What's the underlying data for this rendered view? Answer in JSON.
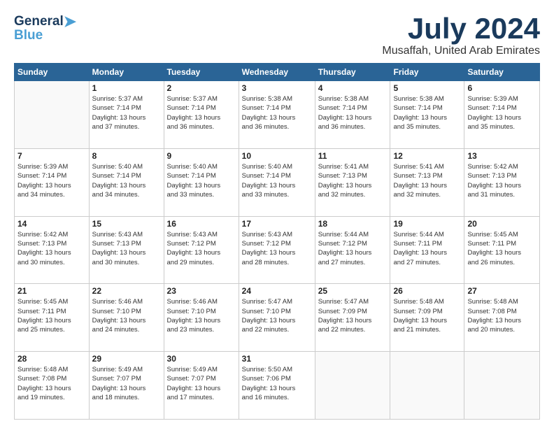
{
  "logo": {
    "line1": "General",
    "line2": "Blue"
  },
  "title": "July 2024",
  "subtitle": "Musaffah, United Arab Emirates",
  "days_header": [
    "Sunday",
    "Monday",
    "Tuesday",
    "Wednesday",
    "Thursday",
    "Friday",
    "Saturday"
  ],
  "weeks": [
    [
      {
        "day": "",
        "info": ""
      },
      {
        "day": "1",
        "info": "Sunrise: 5:37 AM\nSunset: 7:14 PM\nDaylight: 13 hours\nand 37 minutes."
      },
      {
        "day": "2",
        "info": "Sunrise: 5:37 AM\nSunset: 7:14 PM\nDaylight: 13 hours\nand 36 minutes."
      },
      {
        "day": "3",
        "info": "Sunrise: 5:38 AM\nSunset: 7:14 PM\nDaylight: 13 hours\nand 36 minutes."
      },
      {
        "day": "4",
        "info": "Sunrise: 5:38 AM\nSunset: 7:14 PM\nDaylight: 13 hours\nand 36 minutes."
      },
      {
        "day": "5",
        "info": "Sunrise: 5:38 AM\nSunset: 7:14 PM\nDaylight: 13 hours\nand 35 minutes."
      },
      {
        "day": "6",
        "info": "Sunrise: 5:39 AM\nSunset: 7:14 PM\nDaylight: 13 hours\nand 35 minutes."
      }
    ],
    [
      {
        "day": "7",
        "info": "Sunrise: 5:39 AM\nSunset: 7:14 PM\nDaylight: 13 hours\nand 34 minutes."
      },
      {
        "day": "8",
        "info": "Sunrise: 5:40 AM\nSunset: 7:14 PM\nDaylight: 13 hours\nand 34 minutes."
      },
      {
        "day": "9",
        "info": "Sunrise: 5:40 AM\nSunset: 7:14 PM\nDaylight: 13 hours\nand 33 minutes."
      },
      {
        "day": "10",
        "info": "Sunrise: 5:40 AM\nSunset: 7:14 PM\nDaylight: 13 hours\nand 33 minutes."
      },
      {
        "day": "11",
        "info": "Sunrise: 5:41 AM\nSunset: 7:13 PM\nDaylight: 13 hours\nand 32 minutes."
      },
      {
        "day": "12",
        "info": "Sunrise: 5:41 AM\nSunset: 7:13 PM\nDaylight: 13 hours\nand 32 minutes."
      },
      {
        "day": "13",
        "info": "Sunrise: 5:42 AM\nSunset: 7:13 PM\nDaylight: 13 hours\nand 31 minutes."
      }
    ],
    [
      {
        "day": "14",
        "info": "Sunrise: 5:42 AM\nSunset: 7:13 PM\nDaylight: 13 hours\nand 30 minutes."
      },
      {
        "day": "15",
        "info": "Sunrise: 5:43 AM\nSunset: 7:13 PM\nDaylight: 13 hours\nand 30 minutes."
      },
      {
        "day": "16",
        "info": "Sunrise: 5:43 AM\nSunset: 7:12 PM\nDaylight: 13 hours\nand 29 minutes."
      },
      {
        "day": "17",
        "info": "Sunrise: 5:43 AM\nSunset: 7:12 PM\nDaylight: 13 hours\nand 28 minutes."
      },
      {
        "day": "18",
        "info": "Sunrise: 5:44 AM\nSunset: 7:12 PM\nDaylight: 13 hours\nand 27 minutes."
      },
      {
        "day": "19",
        "info": "Sunrise: 5:44 AM\nSunset: 7:11 PM\nDaylight: 13 hours\nand 27 minutes."
      },
      {
        "day": "20",
        "info": "Sunrise: 5:45 AM\nSunset: 7:11 PM\nDaylight: 13 hours\nand 26 minutes."
      }
    ],
    [
      {
        "day": "21",
        "info": "Sunrise: 5:45 AM\nSunset: 7:11 PM\nDaylight: 13 hours\nand 25 minutes."
      },
      {
        "day": "22",
        "info": "Sunrise: 5:46 AM\nSunset: 7:10 PM\nDaylight: 13 hours\nand 24 minutes."
      },
      {
        "day": "23",
        "info": "Sunrise: 5:46 AM\nSunset: 7:10 PM\nDaylight: 13 hours\nand 23 minutes."
      },
      {
        "day": "24",
        "info": "Sunrise: 5:47 AM\nSunset: 7:10 PM\nDaylight: 13 hours\nand 22 minutes."
      },
      {
        "day": "25",
        "info": "Sunrise: 5:47 AM\nSunset: 7:09 PM\nDaylight: 13 hours\nand 22 minutes."
      },
      {
        "day": "26",
        "info": "Sunrise: 5:48 AM\nSunset: 7:09 PM\nDaylight: 13 hours\nand 21 minutes."
      },
      {
        "day": "27",
        "info": "Sunrise: 5:48 AM\nSunset: 7:08 PM\nDaylight: 13 hours\nand 20 minutes."
      }
    ],
    [
      {
        "day": "28",
        "info": "Sunrise: 5:48 AM\nSunset: 7:08 PM\nDaylight: 13 hours\nand 19 minutes."
      },
      {
        "day": "29",
        "info": "Sunrise: 5:49 AM\nSunset: 7:07 PM\nDaylight: 13 hours\nand 18 minutes."
      },
      {
        "day": "30",
        "info": "Sunrise: 5:49 AM\nSunset: 7:07 PM\nDaylight: 13 hours\nand 17 minutes."
      },
      {
        "day": "31",
        "info": "Sunrise: 5:50 AM\nSunset: 7:06 PM\nDaylight: 13 hours\nand 16 minutes."
      },
      {
        "day": "",
        "info": ""
      },
      {
        "day": "",
        "info": ""
      },
      {
        "day": "",
        "info": ""
      }
    ]
  ]
}
